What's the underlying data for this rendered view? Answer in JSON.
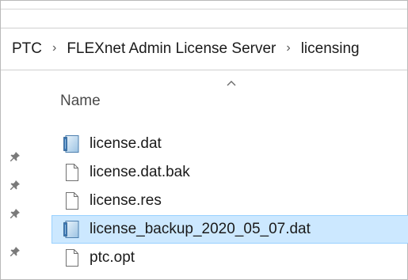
{
  "breadcrumb": {
    "items": [
      {
        "label": "PTC"
      },
      {
        "label": "FLEXnet Admin License Server"
      },
      {
        "label": "licensing"
      }
    ]
  },
  "file_list": {
    "column_header": "Name",
    "files": [
      {
        "name": "license.dat",
        "icon": "dat-file-icon",
        "selected": false
      },
      {
        "name": "license.dat.bak",
        "icon": "blank-file-icon",
        "selected": false
      },
      {
        "name": "license.res",
        "icon": "blank-file-icon",
        "selected": false
      },
      {
        "name": "license_backup_2020_05_07.dat",
        "icon": "dat-file-icon",
        "selected": true
      },
      {
        "name": "ptc.opt",
        "icon": "blank-file-icon",
        "selected": false
      }
    ]
  },
  "colors": {
    "selection_fill": "#cce8ff",
    "selection_border": "#99d1ff"
  }
}
